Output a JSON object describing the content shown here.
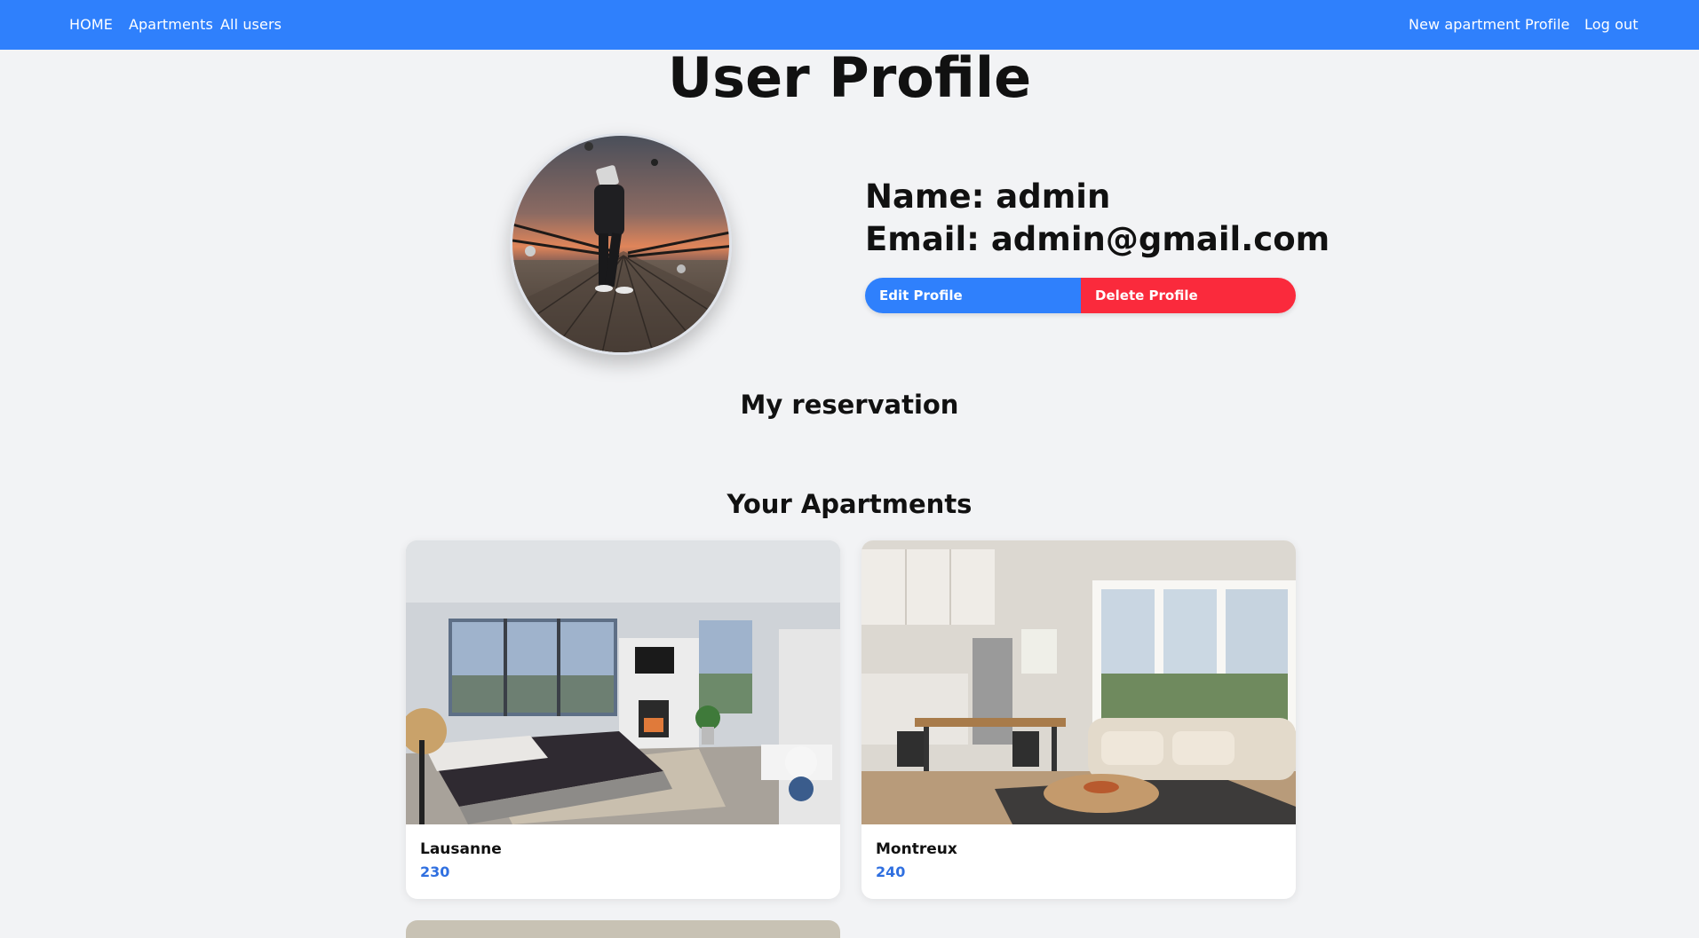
{
  "nav": {
    "left": [
      "HOME",
      "Apartments",
      "All users"
    ],
    "right": [
      "New apartment",
      "Profile",
      "Log out"
    ]
  },
  "page_title": "User Profile",
  "profile": {
    "name_line": "Name: admin",
    "email_line": "Email: admin@gmail.com",
    "edit_label": "Edit Profile",
    "delete_label": "Delete Profile"
  },
  "sections": {
    "reservation_heading": "My reservation",
    "apartments_heading": "Your Apartments"
  },
  "apartments": [
    {
      "title": "Lausanne",
      "price": "230"
    },
    {
      "title": "Montreux",
      "price": "240"
    }
  ],
  "colors": {
    "primary": "#2f80fc",
    "danger": "#fa2a3c",
    "price": "#2f6fe0",
    "background": "#f2f3f5"
  }
}
